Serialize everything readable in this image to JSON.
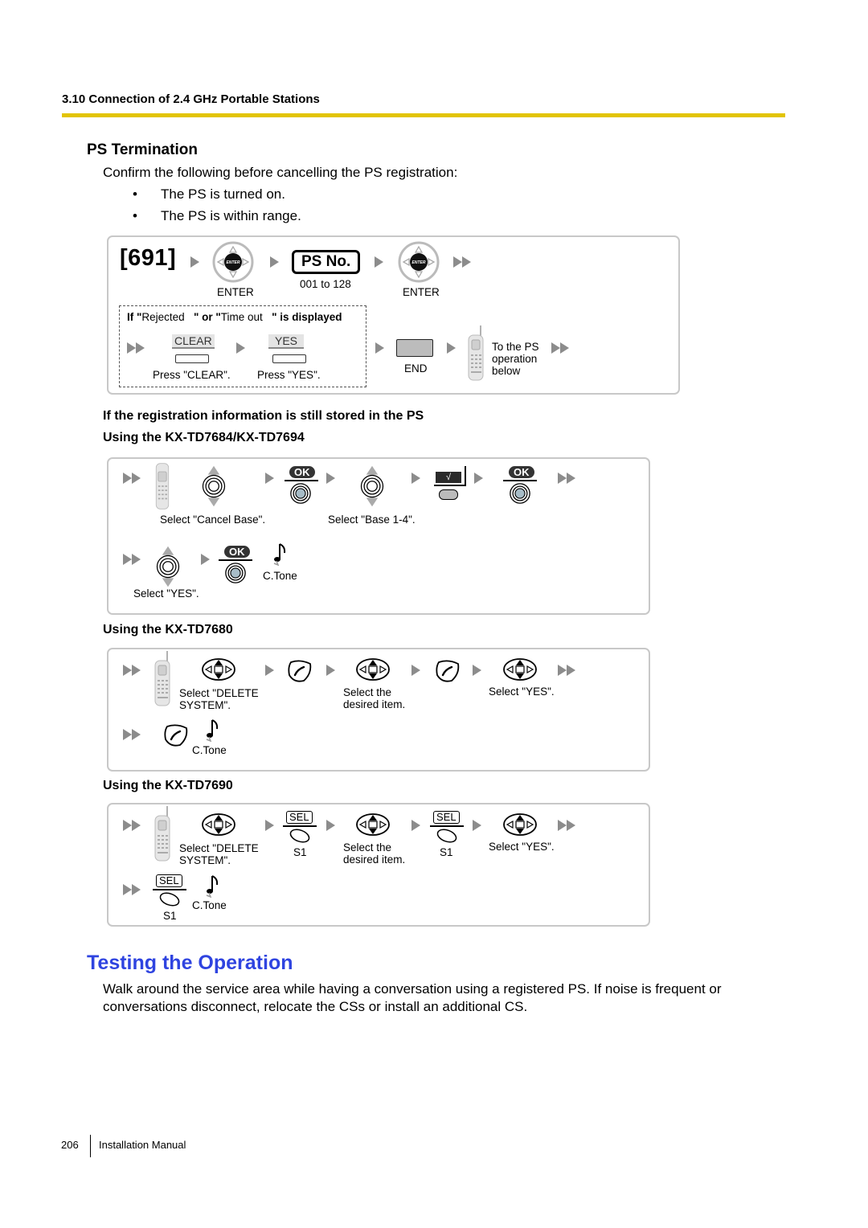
{
  "header": {
    "section": "3.10 Connection of 2.4 GHz Portable Stations",
    "accent_color": "#e2c400"
  },
  "ps_termination": {
    "title": "PS Termination",
    "intro": "Confirm the following before cancelling the PS registration:",
    "bullets": [
      "The PS is turned on.",
      "The PS is within range."
    ],
    "bullet_glyph": "•",
    "flow": {
      "code": "[691]",
      "enter_label": "ENTER",
      "enter_icon_text": "ENTER",
      "ps_no_label": "PS No.",
      "ps_no_range": "001 to 128",
      "enter_label_2": "ENTER",
      "condition_if": "If \"",
      "condition_rejected": "Rejected",
      "condition_or": "\" or \"",
      "condition_timeout": "Time out",
      "condition_displayed": "\" is displayed",
      "clear_key": "CLEAR",
      "yes_key": "YES",
      "press_clear": "Press \"CLEAR\".",
      "press_yes": "Press \"YES\".",
      "end_label": "END",
      "to_ps": [
        "To the PS",
        "operation",
        "below"
      ]
    }
  },
  "registration": {
    "heading": "If the registration information is still stored in the PS",
    "td7684": {
      "heading": "Using the KX-TD7684/KX-TD7694",
      "ok_label": "OK",
      "check_glyph": "√",
      "select_cancel_base": "Select \"Cancel Base\".",
      "select_base": "Select \"Base 1-4\".",
      "select_yes": "Select \"YES\".",
      "ctone": "C.Tone"
    },
    "td7680": {
      "heading": "Using the KX-TD7680",
      "select_delete": [
        "Select \"DELETE",
        "SYSTEM\"."
      ],
      "select_item": [
        "Select the",
        "desired item."
      ],
      "select_yes": "Select \"YES\".",
      "ctone": "C.Tone"
    },
    "td7690": {
      "heading": "Using the KX-TD7690",
      "sel_label": "SEL",
      "s1_label": "S1",
      "select_delete": [
        "Select \"DELETE",
        "SYSTEM\"."
      ],
      "select_item": [
        "Select the",
        "desired item."
      ],
      "select_yes": "Select \"YES\".",
      "ctone": "C.Tone"
    }
  },
  "testing": {
    "title": "Testing the Operation",
    "title_color": "#2f44e0",
    "body": [
      "Walk around the service area while having a conversation using a registered PS. If noise is frequent or",
      "conversations disconnect, relocate the CSs or install an additional CS."
    ]
  },
  "footer": {
    "page_number": "206",
    "manual_title": "Installation Manual"
  }
}
